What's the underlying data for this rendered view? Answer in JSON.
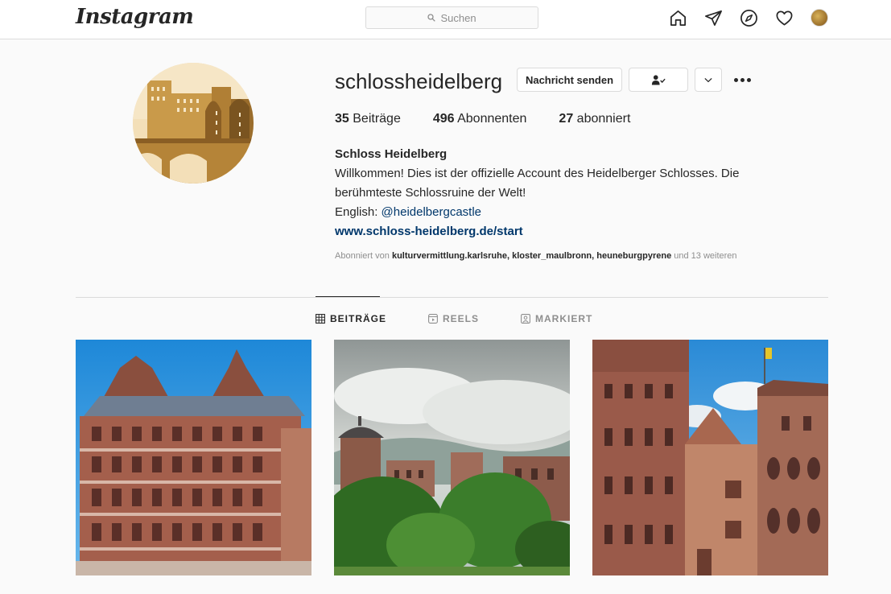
{
  "header": {
    "logo_text": "Instagram",
    "search_placeholder": "Suchen",
    "icons": [
      "home-icon",
      "direct-message-icon",
      "explore-icon",
      "activity-heart-icon",
      "profile-avatar"
    ]
  },
  "profile": {
    "username": "schlossheidelberg",
    "buttons": {
      "message": "Nachricht senden",
      "following_icon": "person-check-icon",
      "suggestions_icon": "chevron-down-icon",
      "options_icon": "more-options-icon"
    },
    "stats": {
      "posts_count": "35",
      "posts_label": "Beiträge",
      "followers_count": "496",
      "followers_label": "Abonnenten",
      "following_count": "27",
      "following_label": "abonniert"
    },
    "bio": {
      "full_name": "Schloss Heidelberg",
      "line1": "Willkommen! Dies ist der offizielle Account des Heidelberger Schlosses. Die berühmteste Schlossruine der Welt!",
      "english_label": "English:",
      "mention": "@heidelbergcastle",
      "website": "www.schloss-heidelberg.de/start"
    },
    "followed_by": {
      "prefix": "Abonniert von",
      "accounts": [
        "kulturvermittlung.karlsruhe",
        "kloster_maulbronn",
        "heuneburgpyrene"
      ],
      "suffix": "und 13 weiteren"
    }
  },
  "tabs": [
    {
      "label": "BEITRÄGE",
      "icon": "grid-icon",
      "active": true
    },
    {
      "label": "REELS",
      "icon": "reels-icon",
      "active": false
    },
    {
      "label": "MARKIERT",
      "icon": "tagged-icon",
      "active": false
    }
  ],
  "posts": [
    {
      "subject": "castle-facade-photo"
    },
    {
      "subject": "castle-ruin-landscape-photo"
    },
    {
      "subject": "castle-courtyard-photo"
    }
  ],
  "colors": {
    "link": "#00376b",
    "border": "#dbdbdb",
    "muted": "#8e8e8e",
    "text": "#262626",
    "background": "#fafafa",
    "logo_gold": "#c79a45"
  }
}
